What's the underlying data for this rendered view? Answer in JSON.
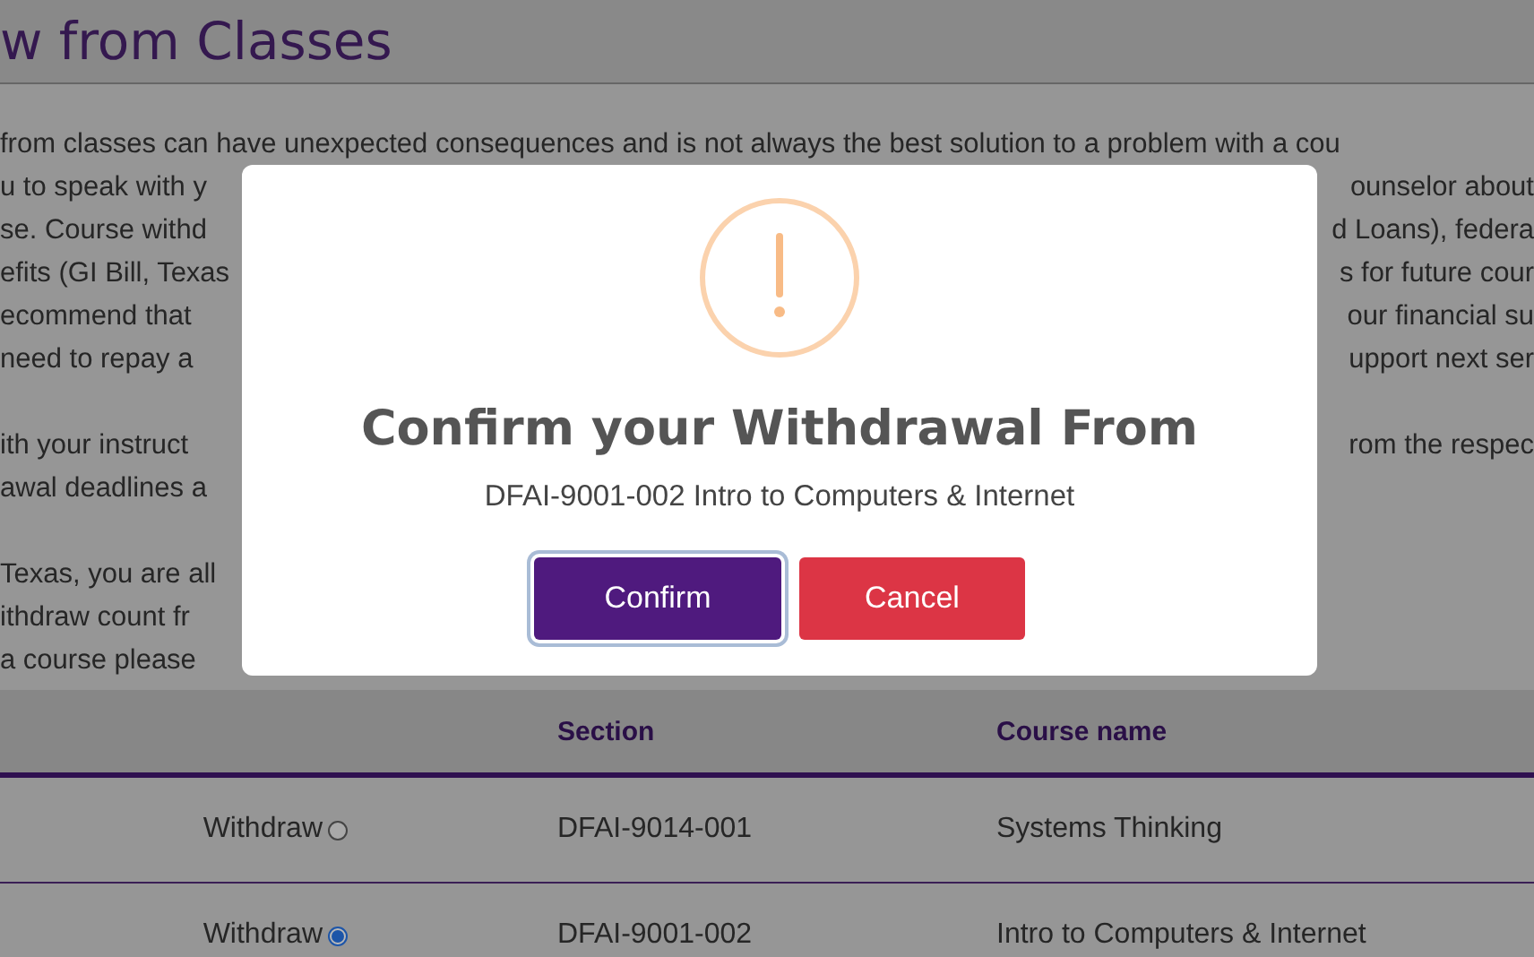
{
  "page": {
    "title": "w from Classes",
    "paragraphs": [
      [
        {
          "left": "from classes can have unexpected consequences and is not always the best solution to a problem with a cou"
        },
        {
          "left": "u to speak with y",
          "right": "ounselor about"
        },
        {
          "left": "se. Course withd",
          "right": "d Loans), federa"
        },
        {
          "left": "efits (GI Bill, Texas",
          "right": "s for future cour"
        },
        {
          "left": "ecommend that",
          "right": "our financial su"
        },
        {
          "left": "need to repay a",
          "right": "upport next ser"
        }
      ],
      [
        {
          "left": "ith your instruct",
          "right": "rom the respec"
        },
        {
          "left": "awal deadlines a"
        }
      ],
      [
        {
          "left": "Texas, you are all"
        },
        {
          "left": "ithdraw count fr"
        },
        {
          "left": "a course please"
        }
      ]
    ]
  },
  "table": {
    "columns": [
      "Section",
      "Course name"
    ],
    "rows": [
      {
        "action": "Withdraw",
        "selected": false,
        "section": "DFAI-9014-001",
        "course": "Systems Thinking"
      },
      {
        "action": "Withdraw",
        "selected": true,
        "section": "DFAI-9001-002",
        "course": "Intro to Computers & Internet"
      }
    ]
  },
  "dialog": {
    "title": "Confirm your Withdrawal From",
    "subtitle": "DFAI-9001-002 Intro to Computers & Internet",
    "buttons": [
      {
        "label": "Confirm",
        "kind": "primary"
      },
      {
        "label": "Cancel",
        "kind": "danger"
      }
    ]
  }
}
